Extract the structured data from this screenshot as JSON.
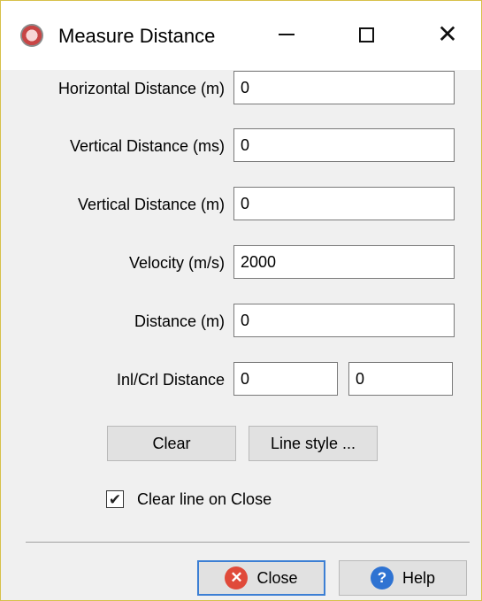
{
  "window": {
    "title": "Measure Distance",
    "buttons": {
      "minimize": "minimize",
      "maximize": "maximize",
      "close": "close"
    }
  },
  "form": {
    "horizontal_distance": {
      "label": "Horizontal Distance (m)",
      "value": "0"
    },
    "vertical_distance_ms": {
      "label": "Vertical Distance (ms)",
      "value": "0"
    },
    "vertical_distance_m": {
      "label": "Vertical Distance (m)",
      "value": "0"
    },
    "velocity": {
      "label": "Velocity (m/s)",
      "value": "2000"
    },
    "distance": {
      "label": "Distance (m)",
      "value": "0"
    },
    "inl_crl_distance": {
      "label": "Inl/Crl Distance",
      "inl_value": "0",
      "crl_value": "0"
    }
  },
  "actions": {
    "clear_label": "Clear",
    "line_style_label": "Line style ...",
    "clear_on_close_label": "Clear line on Close",
    "clear_on_close_checked": true
  },
  "footer": {
    "close_label": "Close",
    "help_label": "Help"
  },
  "icons": {
    "app": "measure-app-icon",
    "close": "close-circle-icon",
    "help": "help-circle-icon"
  }
}
